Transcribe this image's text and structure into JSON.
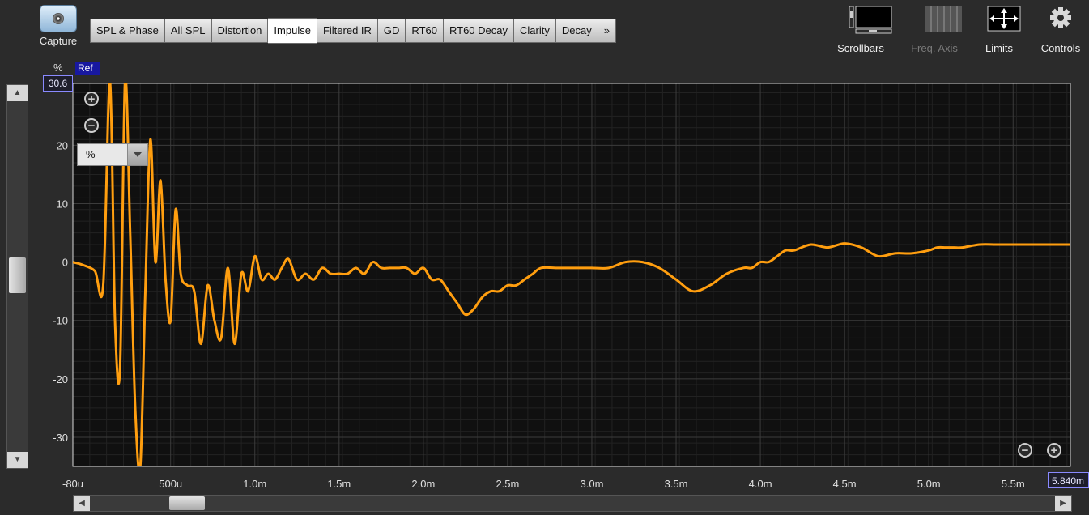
{
  "capture": {
    "label": "Capture",
    "icon": "camera-icon"
  },
  "tabs": [
    {
      "label": "SPL & Phase",
      "active": false
    },
    {
      "label": "All SPL",
      "active": false
    },
    {
      "label": "Distortion",
      "active": false
    },
    {
      "label": "Impulse",
      "active": true
    },
    {
      "label": "Filtered IR",
      "active": false
    },
    {
      "label": "GD",
      "active": false
    },
    {
      "label": "RT60",
      "active": false
    },
    {
      "label": "RT60 Decay",
      "active": false
    },
    {
      "label": "Clarity",
      "active": false
    },
    {
      "label": "Decay",
      "active": false
    },
    {
      "label": "»",
      "active": false
    }
  ],
  "toolbar": {
    "scrollbars": "Scrollbars",
    "freq_axis": "Freq. Axis",
    "limits": "Limits",
    "controls": "Controls"
  },
  "plot": {
    "unit_label": "%",
    "ref_label": "Ref",
    "ymax_value": "30.6",
    "xmax_value": "5.840m",
    "unit_select": "%",
    "colors": {
      "trace": "#ff9e0f",
      "grid": "#3c3c3c",
      "background": "#101010",
      "frame": "#d8d8d8"
    }
  },
  "chart_data": {
    "type": "line",
    "ylim": [
      -35,
      30.6
    ],
    "xlim": [
      -0.08,
      5.84
    ],
    "y_ticks": [
      {
        "v": 20,
        "l": "20"
      },
      {
        "v": 10,
        "l": "10"
      },
      {
        "v": 0,
        "l": "0"
      },
      {
        "v": -10,
        "l": "-10"
      },
      {
        "v": -20,
        "l": "-20"
      },
      {
        "v": -30,
        "l": "-30"
      }
    ],
    "x_ticks": [
      {
        "v": -0.08,
        "l": "-80u"
      },
      {
        "v": 0.5,
        "l": "500u"
      },
      {
        "v": 1.0,
        "l": "1.0m"
      },
      {
        "v": 1.5,
        "l": "1.5m"
      },
      {
        "v": 2.0,
        "l": "2.0m"
      },
      {
        "v": 2.5,
        "l": "2.5m"
      },
      {
        "v": 3.0,
        "l": "3.0m"
      },
      {
        "v": 3.5,
        "l": "3.5m"
      },
      {
        "v": 4.0,
        "l": "4.0m"
      },
      {
        "v": 4.5,
        "l": "4.5m"
      },
      {
        "v": 5.0,
        "l": "5.0m"
      },
      {
        "v": 5.5,
        "l": "5.5m"
      }
    ],
    "series": [
      {
        "x": [
          -0.08,
          -0.02,
          0.05,
          0.1,
          0.14,
          0.17,
          0.2,
          0.23,
          0.26,
          0.29,
          0.32,
          0.35,
          0.38,
          0.41,
          0.44,
          0.47,
          0.5,
          0.53,
          0.56,
          0.6,
          0.64,
          0.68,
          0.72,
          0.76,
          0.8,
          0.84,
          0.88,
          0.92,
          0.96,
          1.0,
          1.04,
          1.08,
          1.12,
          1.16,
          1.2,
          1.25,
          1.3,
          1.35,
          1.4,
          1.45,
          1.5,
          1.55,
          1.6,
          1.65,
          1.7,
          1.75,
          1.8,
          1.85,
          1.9,
          1.95,
          2.0,
          2.05,
          2.1,
          2.15,
          2.2,
          2.25,
          2.3,
          2.35,
          2.4,
          2.45,
          2.5,
          2.55,
          2.6,
          2.65,
          2.7,
          2.8,
          2.9,
          3.0,
          3.1,
          3.2,
          3.3,
          3.4,
          3.5,
          3.6,
          3.7,
          3.8,
          3.9,
          3.95,
          4.0,
          4.05,
          4.1,
          4.15,
          4.2,
          4.3,
          4.4,
          4.5,
          4.6,
          4.7,
          4.8,
          4.9,
          5.0,
          5.05,
          5.1,
          5.15,
          5.2,
          5.3,
          5.4,
          5.5,
          5.6,
          5.7,
          5.84
        ],
        "y": [
          0,
          -0.5,
          -1.5,
          -4,
          31,
          -10,
          -18,
          31,
          5,
          -25,
          -35,
          -5,
          21,
          0,
          14,
          -3,
          -10,
          9,
          -2,
          -4,
          -5,
          -14,
          -4,
          -10,
          -13,
          -1,
          -14,
          -2,
          -5,
          1,
          -3,
          -2,
          -3,
          -1,
          0.5,
          -3,
          -2,
          -3,
          -1,
          -2,
          -2,
          -2,
          -1,
          -2,
          0,
          -1,
          -1,
          -1,
          -1,
          -2,
          -1,
          -3,
          -3,
          -5,
          -7,
          -9,
          -8,
          -6,
          -5,
          -5,
          -4,
          -4,
          -3,
          -2,
          -1,
          -1,
          -1,
          -1,
          -1,
          0,
          0,
          -1,
          -3,
          -5,
          -4,
          -2,
          -1,
          -1,
          0,
          0,
          1,
          2,
          2,
          3,
          2.5,
          3.2,
          2.5,
          1,
          1.5,
          1.5,
          2,
          2.5,
          2.5,
          2.5,
          2.5,
          3,
          3,
          3,
          3,
          3,
          3
        ]
      }
    ]
  }
}
